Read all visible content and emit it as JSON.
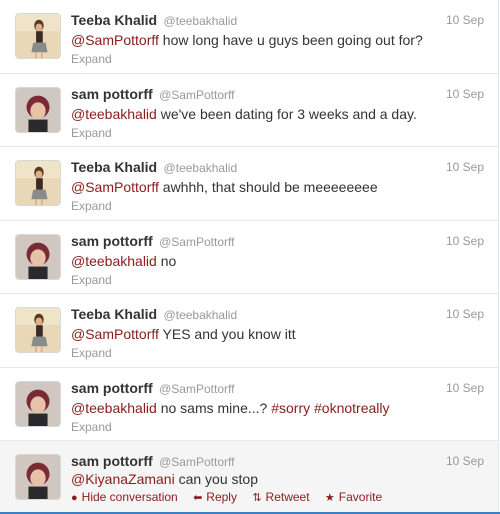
{
  "tweets": [
    {
      "name": "Teeba Khalid",
      "handle": "@teebakhalid",
      "time": "10 Sep",
      "mention": "@SamPottorff",
      "text": " how long have u guys been going out for?",
      "expand": "Expand",
      "avatar": "girl-avatar"
    },
    {
      "name": "sam pottorff",
      "handle": "@SamPottorff",
      "time": "10 Sep",
      "mention": "@teebakhalid",
      "text": " we've been dating for 3 weeks and a day.",
      "expand": "Expand",
      "avatar": "boy-avatar"
    },
    {
      "name": "Teeba Khalid",
      "handle": "@teebakhalid",
      "time": "10 Sep",
      "mention": "@SamPottorff",
      "text": " awhhh, that should be meeeeeeee",
      "expand": "Expand",
      "avatar": "girl-avatar"
    },
    {
      "name": "sam pottorff",
      "handle": "@SamPottorff",
      "time": "10 Sep",
      "mention": "@teebakhalid",
      "text": " no",
      "expand": "Expand",
      "avatar": "boy-avatar"
    },
    {
      "name": "Teeba Khalid",
      "handle": "@teebakhalid",
      "time": "10 Sep",
      "mention": "@SamPottorff",
      "text": " YES and you know itt",
      "expand": "Expand",
      "avatar": "girl-avatar"
    },
    {
      "name": "sam pottorff",
      "handle": "@SamPottorff",
      "time": "10 Sep",
      "mention": "@teebakhalid",
      "text": " no sams mine...? ",
      "hashtag1": "#sorry",
      "hashtag2": "#oknotreally",
      "expand": "Expand",
      "avatar": "boy-avatar"
    },
    {
      "name": "sam pottorff",
      "handle": "@SamPottorff",
      "time": "10 Sep",
      "mention": "@KiyanaZamani",
      "text": " can you stop",
      "avatar": "boy-avatar",
      "actions": {
        "hide": "Hide conversation",
        "reply": "Reply",
        "retweet": "Retweet",
        "favorite": "Favorite"
      }
    }
  ],
  "colors": {
    "link": "#8a1c1c",
    "muted": "#999999",
    "text": "#333333"
  }
}
